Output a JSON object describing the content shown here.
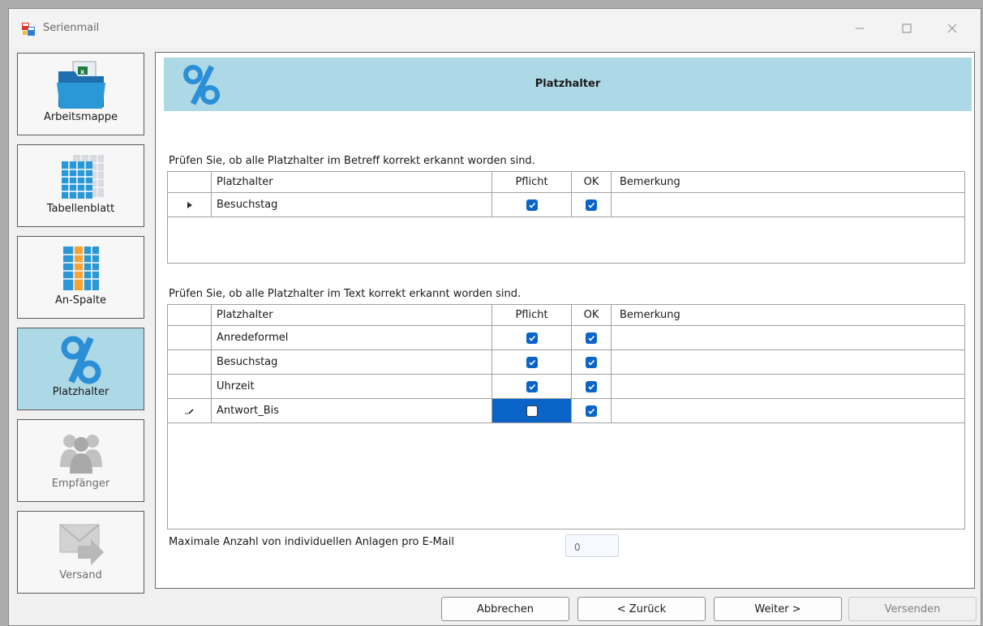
{
  "window": {
    "title": "Serienmail"
  },
  "nav": {
    "items": [
      {
        "label": "Arbeitsmappe",
        "icon": "workbook-icon",
        "active": false,
        "enabled": true
      },
      {
        "label": "Tabellenblatt",
        "icon": "worksheet-icon",
        "active": false,
        "enabled": true
      },
      {
        "label": "An-Spalte",
        "icon": "column-icon",
        "active": false,
        "enabled": true
      },
      {
        "label": "Platzhalter",
        "icon": "percent-icon",
        "active": true,
        "enabled": true
      },
      {
        "label": "Empfänger",
        "icon": "recipients-icon",
        "active": false,
        "enabled": false
      },
      {
        "label": "Versand",
        "icon": "mail-send-icon",
        "active": false,
        "enabled": false
      }
    ]
  },
  "header": {
    "title": "Platzhalter",
    "icon": "percent-icon"
  },
  "subject_section": {
    "caption": "Prüfen Sie, ob alle Platzhalter im Betreff korrekt erkannt worden sind.",
    "columns": [
      "Platzhalter",
      "Pflicht",
      "OK",
      "Bemerkung"
    ],
    "rows": [
      {
        "marker": "current-row",
        "name": "Besuchstag",
        "pflicht": true,
        "ok": true,
        "bemerkung": ""
      }
    ]
  },
  "text_section": {
    "caption": "Prüfen Sie, ob alle Platzhalter im Text korrekt erkannt worden sind.",
    "columns": [
      "Platzhalter",
      "Pflicht",
      "OK",
      "Bemerkung"
    ],
    "rows": [
      {
        "marker": "",
        "name": "Anredeformel",
        "pflicht": true,
        "ok": true,
        "bemerkung": ""
      },
      {
        "marker": "",
        "name": "Besuchstag",
        "pflicht": true,
        "ok": true,
        "bemerkung": ""
      },
      {
        "marker": "",
        "name": "Uhrzeit",
        "pflicht": true,
        "ok": true,
        "bemerkung": ""
      },
      {
        "marker": "editing-row",
        "name": "Antwort_Bis",
        "pflicht": false,
        "ok": true,
        "bemerkung": ""
      }
    ]
  },
  "attachments": {
    "label": "Maximale Anzahl von individuellen Anlagen pro E-Mail",
    "value": "0"
  },
  "buttons": {
    "cancel": "Abbrechen",
    "back": "< Zurück",
    "next": "Weiter >",
    "send": "Versenden"
  },
  "colors": {
    "accent": "#0a64c8",
    "header_bg": "#add8e6"
  }
}
